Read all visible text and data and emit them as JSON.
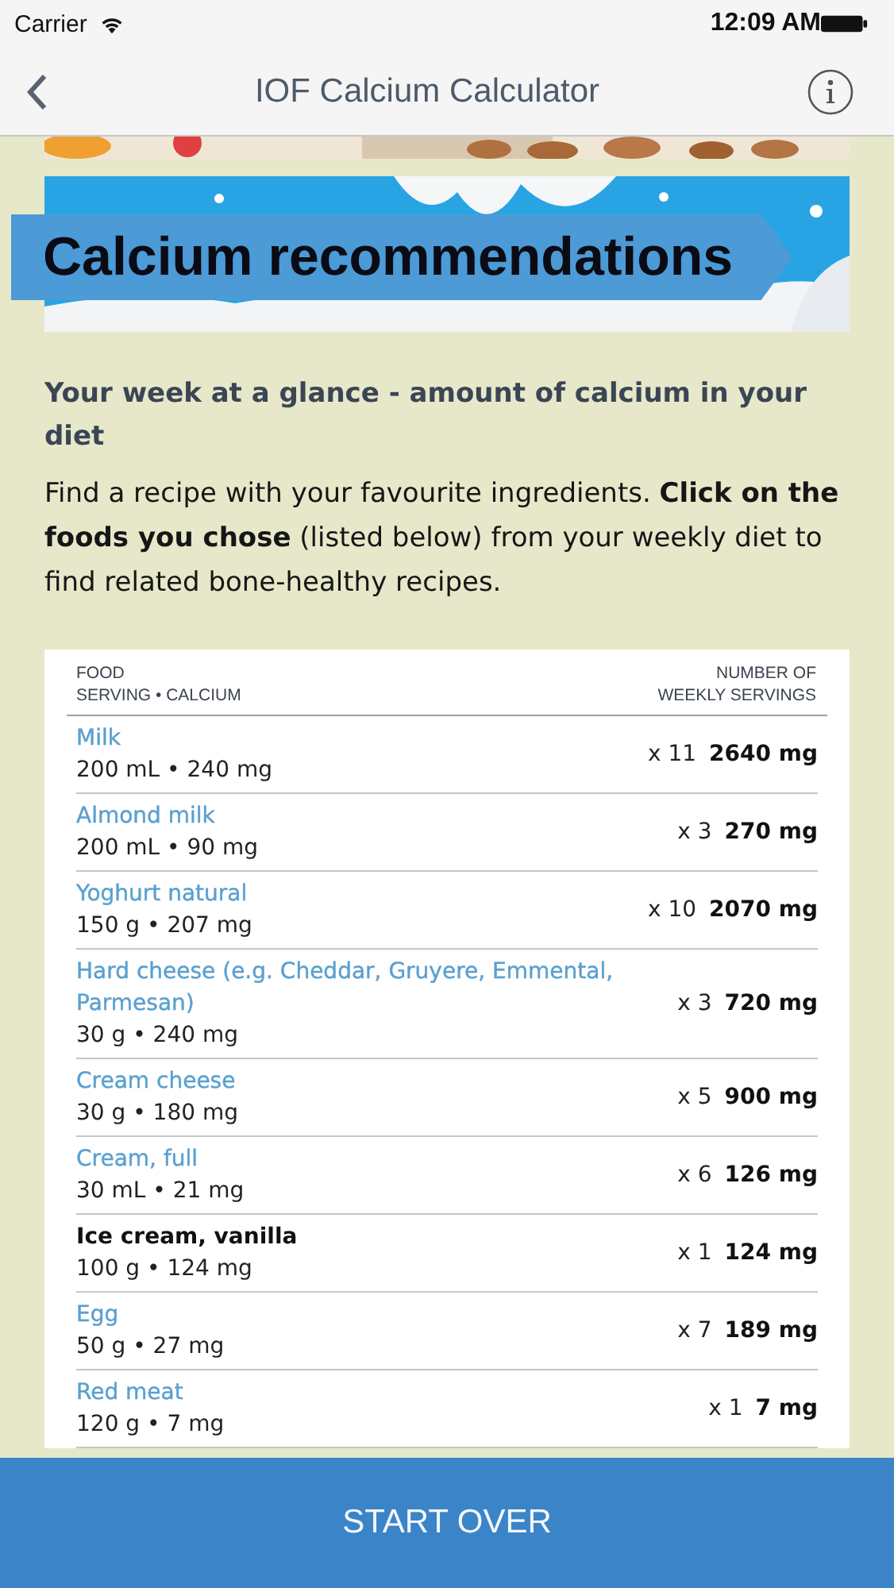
{
  "status_bar": {
    "carrier": "Carrier",
    "time": "12:09 AM"
  },
  "nav_bar": {
    "title": "IOF Calcium Calculator"
  },
  "banner": {
    "title": "Calcium recommendations"
  },
  "heading": "Your week at a glance - amount of calcium in your diet",
  "intro": "Find a recipe with your favourite ingredients. **Click on the foods you chose** (listed below) from your weekly diet to find related bone-healthy recipes.",
  "table": {
    "header_left": [
      "FOOD",
      "SERVING • CALCIUM"
    ],
    "header_right": [
      "NUMBER OF",
      "WEEKLY SERVINGS"
    ],
    "rows": [
      {
        "food": "Milk",
        "linked": true,
        "serving": "200 mL • 240 mg",
        "count": "x 11",
        "total": "2640 mg"
      },
      {
        "food": "Almond milk",
        "linked": true,
        "serving": "200 mL • 90 mg",
        "count": "x 3",
        "total": "270 mg"
      },
      {
        "food": "Yoghurt natural",
        "linked": true,
        "serving": "150 g • 207 mg",
        "count": "x 10",
        "total": "2070 mg"
      },
      {
        "food": "Hard cheese (e.g. Cheddar, Gruyere, Emmental, Parmesan)",
        "linked": true,
        "serving": "30 g • 240 mg",
        "count": "x 3",
        "total": "720 mg"
      },
      {
        "food": "Cream cheese",
        "linked": true,
        "serving": "30 g • 180 mg",
        "count": "x 5",
        "total": "900 mg"
      },
      {
        "food": "Cream, full",
        "linked": true,
        "serving": "30 mL • 21 mg",
        "count": "x 6",
        "total": "126 mg"
      },
      {
        "food": "Ice cream, vanilla",
        "linked": false,
        "serving": "100 g • 124 mg",
        "count": "x 1",
        "total": "124 mg"
      },
      {
        "food": "Egg",
        "linked": true,
        "serving": "50 g • 27 mg",
        "count": "x 7",
        "total": "189 mg"
      },
      {
        "food": "Red meat",
        "linked": true,
        "serving": "120 g • 7 mg",
        "count": "x 1",
        "total": "7 mg"
      }
    ]
  },
  "button": "START OVER"
}
